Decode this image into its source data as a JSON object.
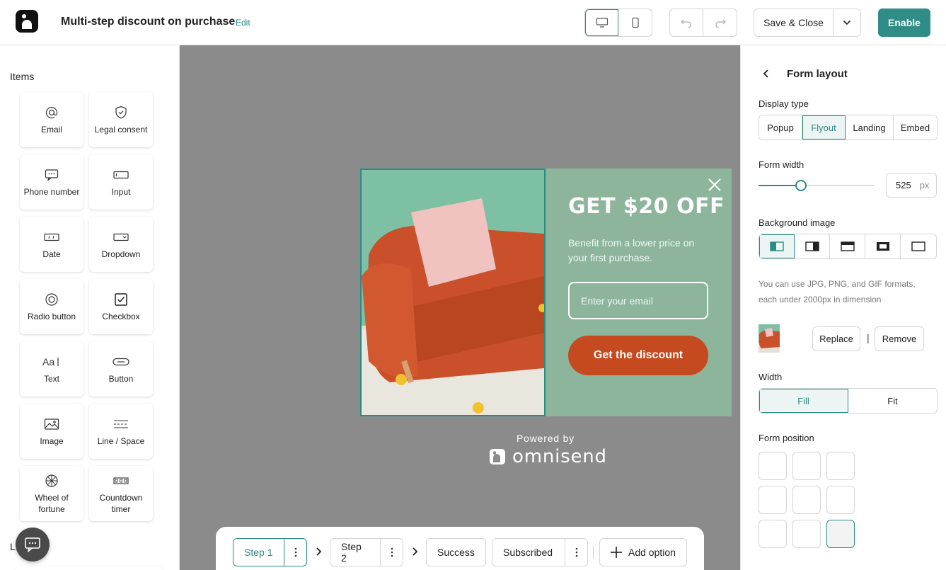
{
  "header": {
    "title": "Multi-step discount on purchase",
    "edit_label": "Edit",
    "save_close_label": "Save & Close",
    "enable_label": "Enable",
    "device_modes": [
      "desktop",
      "mobile"
    ],
    "active_device": "desktop",
    "accent_color": "#2f8c86"
  },
  "left_sidebar": {
    "section_title": "Items",
    "items": [
      {
        "label": "Email",
        "icon": "at-icon"
      },
      {
        "label": "Legal consent",
        "icon": "shield-check-icon"
      },
      {
        "label": "Phone number",
        "icon": "chat-bubble-icon"
      },
      {
        "label": "Input",
        "icon": "input-field-icon"
      },
      {
        "label": "Date",
        "icon": "date-field-icon"
      },
      {
        "label": "Dropdown",
        "icon": "dropdown-field-icon"
      },
      {
        "label": "Radio button",
        "icon": "radio-icon"
      },
      {
        "label": "Checkbox",
        "icon": "checkbox-icon"
      },
      {
        "label": "Text",
        "icon": "text-icon"
      },
      {
        "label": "Button",
        "icon": "button-icon"
      },
      {
        "label": "Image",
        "icon": "image-icon"
      },
      {
        "label": "Line / Space",
        "icon": "line-space-icon"
      },
      {
        "label": "Wheel of fortune",
        "icon": "wheel-icon"
      },
      {
        "label": "Countdown timer",
        "icon": "countdown-icon"
      }
    ],
    "partial_section_letter": "L"
  },
  "form_preview": {
    "heading": "GET $20 OFF",
    "subtext": "Benefit from a lower price on your first purchase.",
    "email_placeholder": "Enter your email",
    "cta_label": "Get the discount",
    "background_color": "#8cb59b",
    "cta_color": "#c64a1f"
  },
  "branding": {
    "powered_by": "Powered by",
    "brand_name": "omnisend"
  },
  "steps": [
    {
      "label": "Step 1",
      "active": true,
      "has_menu": true
    },
    {
      "label": "Step 2",
      "active": false,
      "has_menu": true
    },
    {
      "label": "Success",
      "active": false,
      "has_menu": false
    },
    {
      "label": "Subscribed",
      "active": false,
      "has_menu": true
    }
  ],
  "add_option_label": "Add option",
  "right_panel": {
    "title": "Form layout",
    "display_type_label": "Display type",
    "display_types": [
      "Popup",
      "Flyout",
      "Landing",
      "Embed"
    ],
    "selected_display_type": "Flyout",
    "form_width_label": "Form width",
    "form_width_value": "525",
    "form_width_unit": "px",
    "form_width_slider_fraction": 0.37,
    "background_image_label": "Background image",
    "background_image_options": [
      "image-left-icon",
      "image-right-icon",
      "image-top-icon",
      "image-center-icon",
      "image-full-icon"
    ],
    "selected_background_option": "image-left-icon",
    "hint": "You can use JPG, PNG, and GIF formats, each under 2000px in dimension",
    "replace_label": "Replace",
    "separator": "|",
    "remove_label": "Remove",
    "width_label": "Width",
    "width_options": [
      "Fill",
      "Fit"
    ],
    "selected_width": "Fill",
    "form_position_label": "Form position",
    "form_position_selected": "bottom-right"
  }
}
